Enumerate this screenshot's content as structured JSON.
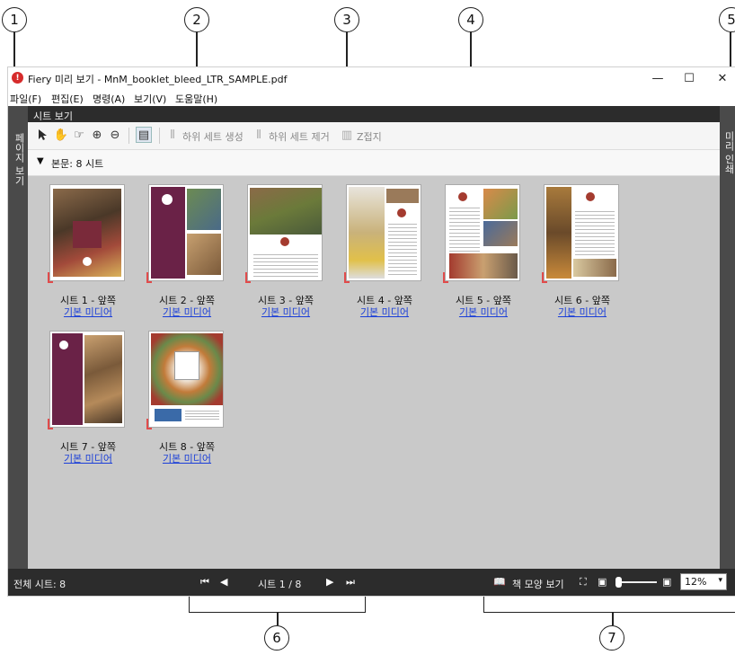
{
  "callouts": [
    "1",
    "2",
    "3",
    "4",
    "5",
    "6",
    "7"
  ],
  "window": {
    "title": "Fiery 미리 보기 - MnM_booklet_bleed_LTR_SAMPLE.pdf",
    "minimize": "—",
    "maximize": "☐",
    "close": "✕"
  },
  "menu": [
    "파일(F)",
    "편집(E)",
    "명령(A)",
    "보기(V)",
    "도움말(H)"
  ],
  "sheet_view_label": "시트 보기",
  "left_panel_label": "페이지 보기",
  "right_panel_label": "미리 인쇄",
  "toolbar": {
    "create_subset": "하위 세트 생성",
    "remove_subset": "하위 세트 제거",
    "z_fold": "Z접지"
  },
  "section": {
    "title": "본문: 8 시트"
  },
  "sheets": [
    {
      "label": "시트 1 - 앞쪽",
      "media": "기본 미디어",
      "accent": "#7a2a3a"
    },
    {
      "label": "시트 2 - 앞쪽",
      "media": "기본 미디어",
      "accent": "#6a2247"
    },
    {
      "label": "시트 3 - 앞쪽",
      "media": "기본 미디어",
      "accent": "#6b7a3a"
    },
    {
      "label": "시트 4 - 앞쪽",
      "media": "기본 미디어",
      "accent": "#b5a57a"
    },
    {
      "label": "시트 5 - 앞쪽",
      "media": "기본 미디어",
      "accent": "#a43b2f"
    },
    {
      "label": "시트 6 - 앞쪽",
      "media": "기본 미디어",
      "accent": "#a87a3c"
    },
    {
      "label": "시트 7 - 앞쪽",
      "media": "기본 미디어",
      "accent": "#6a2247"
    },
    {
      "label": "시트 8 - 앞쪽",
      "media": "기본 미디어",
      "accent": "#c27b3a"
    }
  ],
  "status": {
    "total_sheets": "전체 시트: 8",
    "page_indicator": "시트 1 / 8",
    "book_view": "책 모양 보기",
    "zoom": "12%"
  },
  "colors": {
    "dark_bar": "#2c2c2c",
    "panel": "#4a4a4a",
    "content_bg": "#c9c9c9",
    "link": "#1a3ed8",
    "brand_red": "#d62b2b"
  }
}
